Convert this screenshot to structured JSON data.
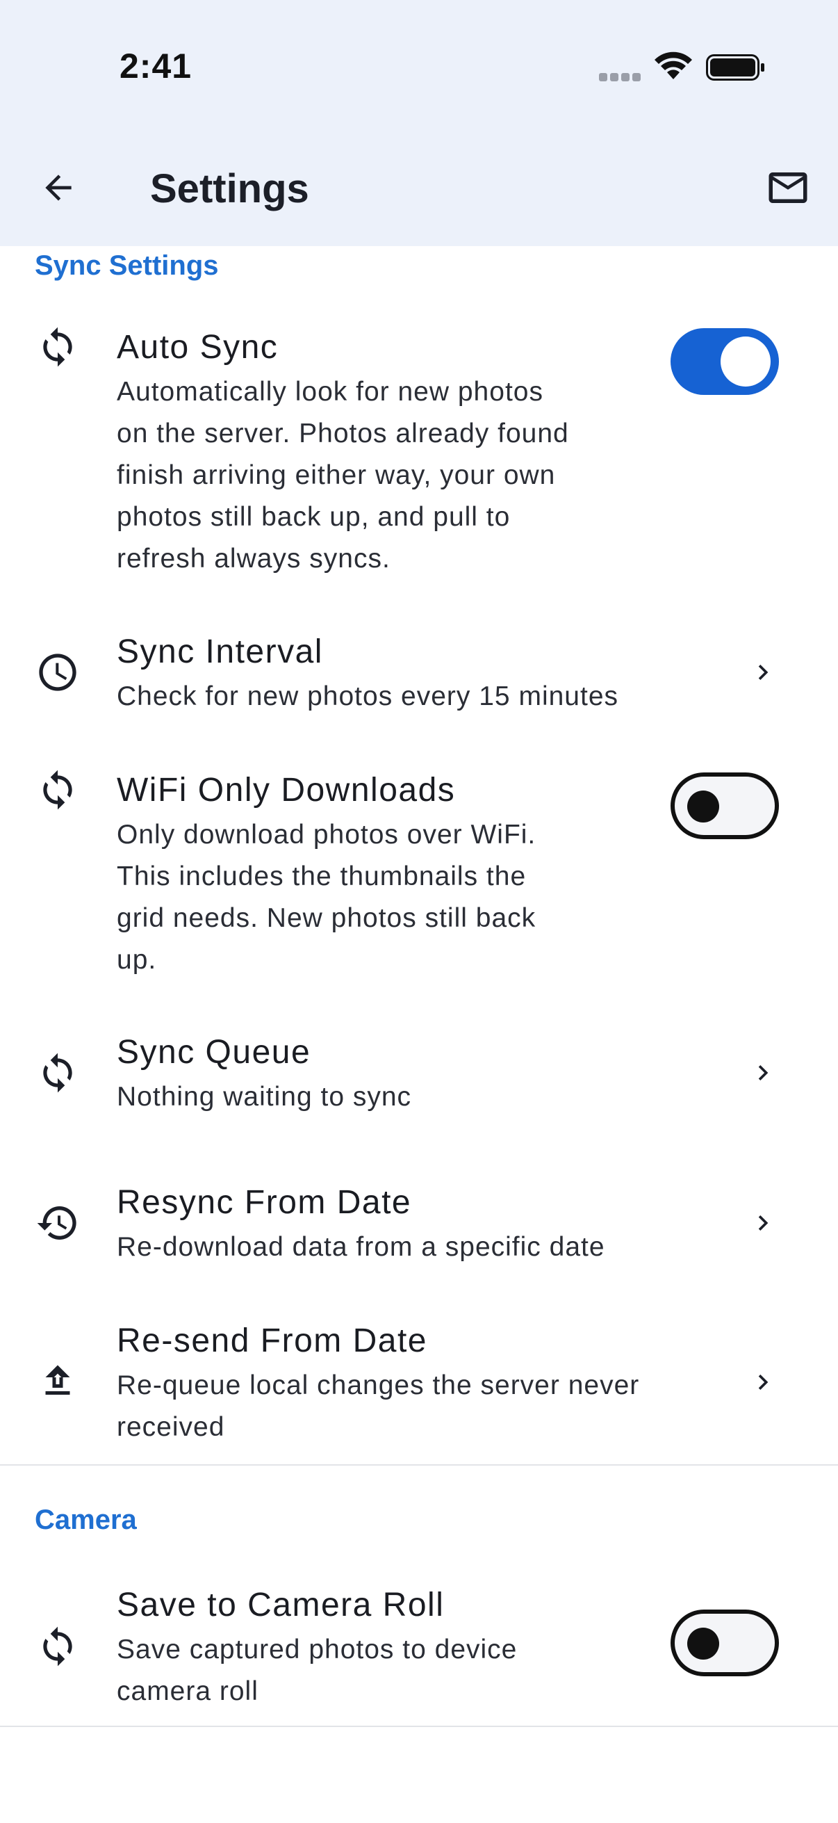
{
  "status_bar": {
    "time": "2:41"
  },
  "header": {
    "title": "Settings"
  },
  "sections": [
    {
      "header": "Sync Settings",
      "items": [
        {
          "title": "Auto Sync",
          "desc": [
            "Automatically look for new photos",
            "on the server. Photos already found",
            "finish arriving either way, your own",
            "photos still back up, and pull to",
            "refresh always syncs."
          ],
          "icon": "sync-icon",
          "control": "toggle",
          "on": true
        },
        {
          "title": "Sync Interval",
          "desc": [
            "Check for new photos every 15 minutes"
          ],
          "icon": "clock-icon",
          "control": "chevron"
        },
        {
          "title": "WiFi Only Downloads",
          "desc": [
            "Only download photos over WiFi.",
            "This includes the thumbnails the",
            "grid needs. New photos still back",
            "up."
          ],
          "icon": "sync-icon",
          "control": "toggle",
          "on": false
        },
        {
          "title": "Sync Queue",
          "desc": [
            "Nothing waiting to sync"
          ],
          "icon": "sync-icon",
          "control": "chevron"
        },
        {
          "title": "Resync From Date",
          "desc": [
            "Re-download data from a specific date"
          ],
          "icon": "history-icon",
          "control": "chevron"
        },
        {
          "title": "Re-send From Date",
          "desc": [
            "Re-queue local changes the server never",
            "received"
          ],
          "icon": "upload-icon",
          "control": "chevron"
        }
      ]
    },
    {
      "header": "Camera",
      "items": [
        {
          "title": "Save to Camera Roll",
          "desc": [
            "Save captured photos to device",
            "camera roll"
          ],
          "icon": "sync-icon",
          "control": "toggle",
          "on": false
        }
      ]
    }
  ],
  "colors": {
    "accent": "#1662d3",
    "section_header": "#1f6fd1",
    "appbar_bg": "#ecf1fa"
  }
}
